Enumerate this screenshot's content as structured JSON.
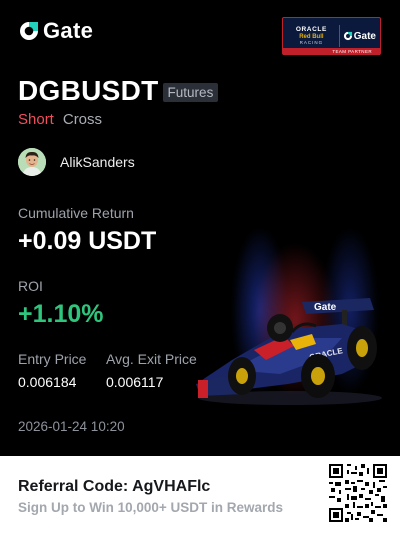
{
  "brand": {
    "name": "Gate",
    "icon": "gate-logo-icon"
  },
  "partner_badge": {
    "oracle": "ORACLE",
    "team": "Red Bull",
    "racing": "RACING",
    "gate": "Gate",
    "footer": "TEAM PARTNER"
  },
  "position": {
    "symbol": "DGBUSDT",
    "market_type": "Futures",
    "side": "Short",
    "margin_mode": "Cross"
  },
  "user": {
    "name": "AlikSanders",
    "avatar_icon": "user-avatar"
  },
  "stats": {
    "cumulative_return_label": "Cumulative Return",
    "cumulative_return_value": "+0.09 USDT",
    "roi_label": "ROI",
    "roi_value": "+1.10%",
    "entry_price_label": "Entry Price",
    "entry_price_value": "0.006184",
    "exit_price_label": "Avg. Exit Price",
    "exit_price_value": "0.006117",
    "timestamp": "2026-01-24 10:20"
  },
  "car_livery": {
    "gate": "Gate",
    "oracle": "ORACLE"
  },
  "referral": {
    "code_line": "Referral Code: AgVHAFlc",
    "promo": "Sign Up to Win 10,000+ USDT in Rewards",
    "qr_icon": "qr-code"
  },
  "colors": {
    "background": "#000000",
    "short": "#f0505c",
    "roi": "#2fc57d",
    "label": "#9ea3ab",
    "partner_bg": "#0b1a3c",
    "partner_red": "#c0202a"
  }
}
